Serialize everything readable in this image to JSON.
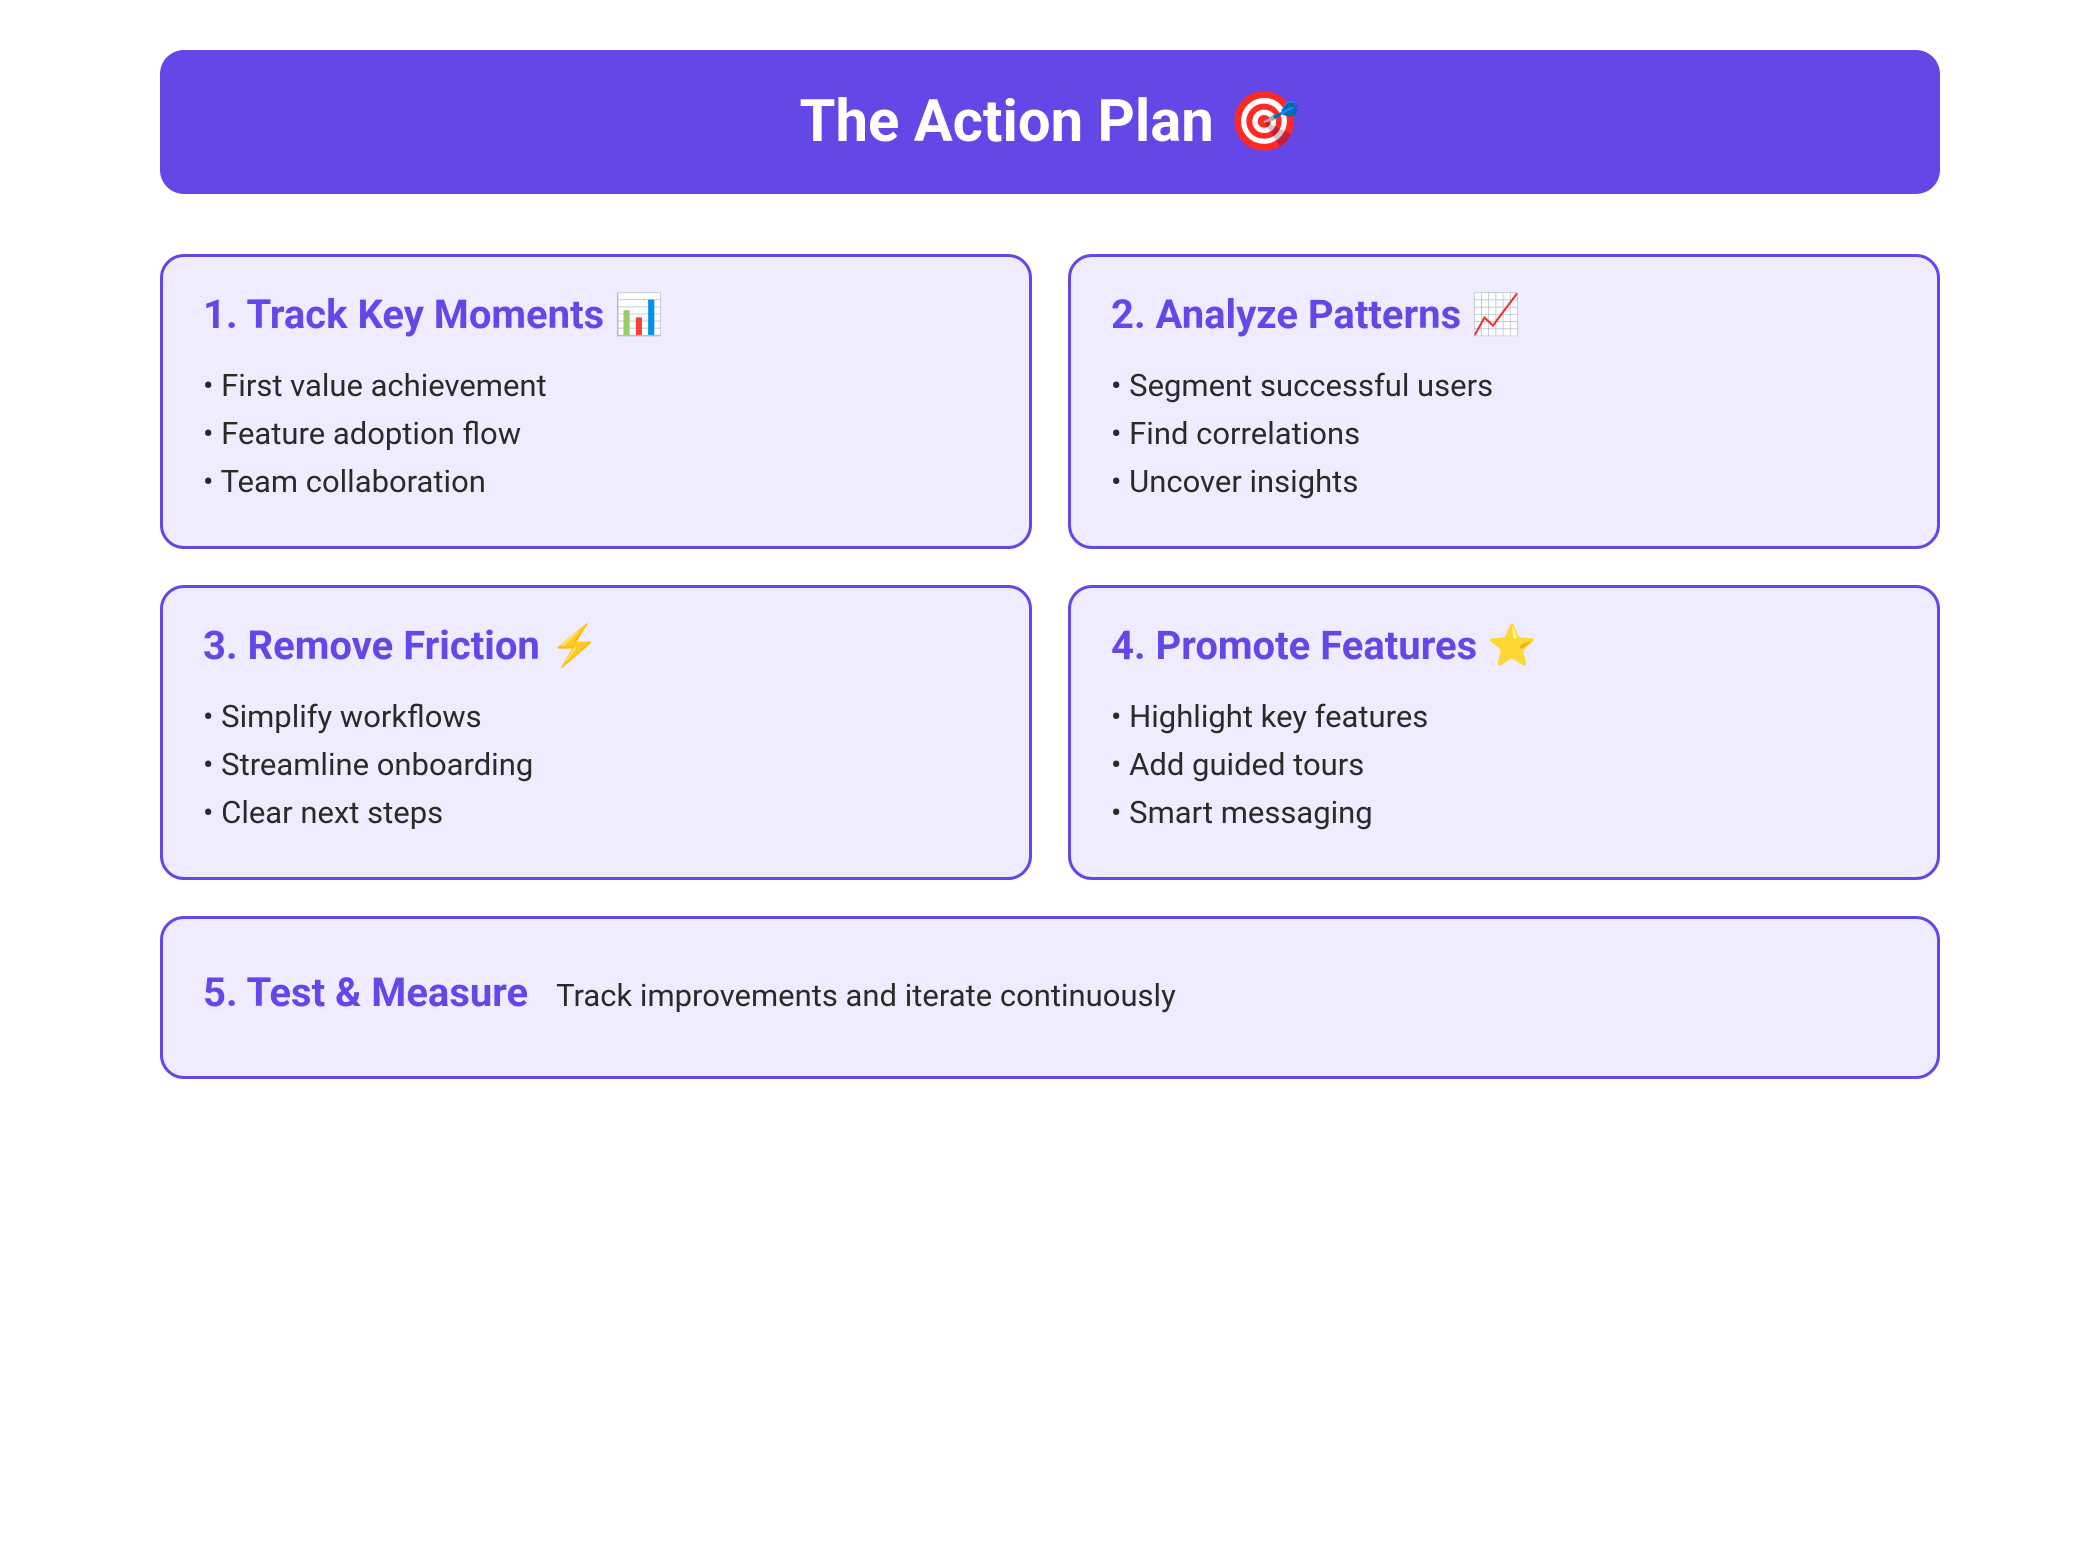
{
  "header": {
    "title": "The Action Plan 🎯"
  },
  "cards": [
    {
      "title": "1. Track Key Moments 📊",
      "items": [
        "First value achievement",
        "Feature adoption flow",
        "Team collaboration"
      ]
    },
    {
      "title": "2. Analyze Patterns 📈",
      "items": [
        "Segment successful users",
        "Find correlations",
        "Uncover insights"
      ]
    },
    {
      "title": "3. Remove Friction ⚡",
      "items": [
        "Simplify workflows",
        "Streamline onboarding",
        "Clear next steps"
      ]
    },
    {
      "title": "4. Promote Features ⭐",
      "items": [
        "Highlight key features",
        "Add guided tours",
        "Smart messaging"
      ]
    }
  ],
  "wide_card": {
    "title": "5. Test & Measure",
    "text": "Track improvements and iterate continuously"
  }
}
